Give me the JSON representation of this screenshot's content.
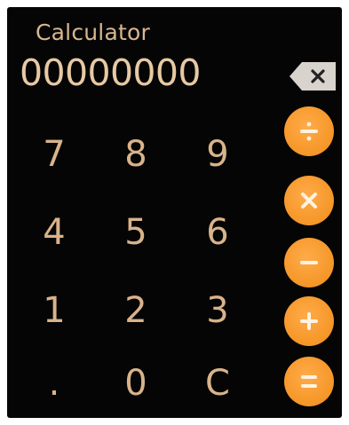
{
  "app": {
    "title": "Calculator"
  },
  "display": {
    "value": "00000000"
  },
  "keypad": {
    "rows": [
      [
        "7",
        "8",
        "9"
      ],
      [
        "4",
        "5",
        "6"
      ],
      [
        "1",
        "2",
        "3"
      ],
      [
        ".",
        "0",
        "C"
      ]
    ]
  },
  "operators": [
    "divide",
    "multiply",
    "subtract",
    "add",
    "equals"
  ],
  "colors": {
    "background": "#050505",
    "digit_text": "#d9b38b",
    "accent": "#f59627",
    "backspace": "#d8d3cd"
  },
  "icons": {
    "backspace": "backspace-icon",
    "divide": "divide-icon",
    "multiply": "multiply-icon",
    "subtract": "minus-icon",
    "add": "plus-icon",
    "equals": "equals-icon"
  }
}
